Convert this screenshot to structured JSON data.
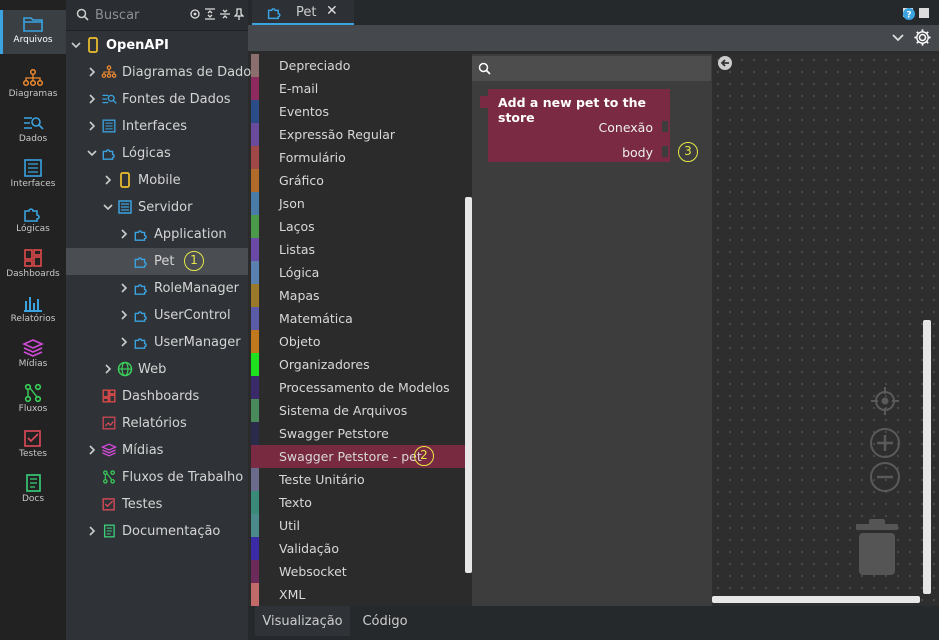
{
  "activity_bar": [
    {
      "label": "Arquivos",
      "icon": "folder-icon",
      "active": true
    },
    {
      "label": "Diagramas",
      "icon": "diagram-icon"
    },
    {
      "label": "Dados",
      "icon": "data-search-icon"
    },
    {
      "label": "Interfaces",
      "icon": "interface-icon"
    },
    {
      "label": "Lógicas",
      "icon": "puzzle-icon"
    },
    {
      "label": "Dashboards",
      "icon": "dashboard-icon"
    },
    {
      "label": "Relatórios",
      "icon": "report-icon"
    },
    {
      "label": "Mídias",
      "icon": "layers-icon"
    },
    {
      "label": "Fluxos",
      "icon": "flow-icon"
    },
    {
      "label": "Testes",
      "icon": "test-check-icon"
    },
    {
      "label": "Docs",
      "icon": "book-icon"
    }
  ],
  "explorer": {
    "search_placeholder": "Buscar",
    "tree": [
      {
        "label": "OpenAPI",
        "icon": "mobile-icon"
      },
      {
        "label": "Diagramas de Dados",
        "icon": "diagram-icon"
      },
      {
        "label": "Fontes de Dados",
        "icon": "data-search-icon"
      },
      {
        "label": "Interfaces",
        "icon": "interface-icon"
      },
      {
        "label": "Lógicas",
        "icon": "puzzle-icon"
      },
      {
        "label": "Mobile",
        "icon": "mobile-icon"
      },
      {
        "label": "Servidor",
        "icon": "server-icon"
      },
      {
        "label": "Application",
        "icon": "puzzle-icon"
      },
      {
        "label": "Pet",
        "icon": "puzzle-icon",
        "selected": true,
        "badge": "1"
      },
      {
        "label": "RoleManager",
        "icon": "puzzle-icon"
      },
      {
        "label": "UserControl",
        "icon": "puzzle-icon"
      },
      {
        "label": "UserManager",
        "icon": "puzzle-icon"
      },
      {
        "label": "Web",
        "icon": "globe-icon"
      },
      {
        "label": "Dashboards",
        "icon": "dashboard-icon"
      },
      {
        "label": "Relatórios",
        "icon": "report-icon"
      },
      {
        "label": "Mídias",
        "icon": "layers-icon"
      },
      {
        "label": "Fluxos de Trabalho",
        "icon": "flow-icon"
      },
      {
        "label": "Testes",
        "icon": "test-check-icon"
      },
      {
        "label": "Documentação",
        "icon": "book-icon"
      }
    ]
  },
  "editor_tab": {
    "label": "Pet",
    "close": "✕"
  },
  "palette": [
    {
      "label": "Depreciado",
      "color": "#8b6e6e"
    },
    {
      "label": "E-mail",
      "color": "#8e2a5e"
    },
    {
      "label": "Eventos",
      "color": "#2a4d88"
    },
    {
      "label": "Expressão Regular",
      "color": "#6a4a9a"
    },
    {
      "label": "Formulário",
      "color": "#a04848"
    },
    {
      "label": "Gráfico",
      "color": "#b06a2a"
    },
    {
      "label": "Json",
      "color": "#4a7aa6"
    },
    {
      "label": "Laços",
      "color": "#4a9a4a"
    },
    {
      "label": "Listas",
      "color": "#6a4aa6"
    },
    {
      "label": "Lógica",
      "color": "#5a80b0"
    },
    {
      "label": "Mapas",
      "color": "#9a7a2a"
    },
    {
      "label": "Matemática",
      "color": "#5a5aa6"
    },
    {
      "label": "Objeto",
      "color": "#c0781c"
    },
    {
      "label": "Organizadores",
      "color": "#1fe01f"
    },
    {
      "label": "Processamento de Modelos",
      "color": "#3a2a6a"
    },
    {
      "label": "Sistema de Arquivos",
      "color": "#4a8a5a"
    },
    {
      "label": "Swagger Petstore",
      "color": "#2a2a4a"
    },
    {
      "label": "Swagger Petstore - pet",
      "color": "#7a2a43",
      "selected": true,
      "badge": "2"
    },
    {
      "label": "Teste Unitário",
      "color": "#6a6a8a"
    },
    {
      "label": "Texto",
      "color": "#3a8a7a"
    },
    {
      "label": "Util",
      "color": "#4a8a8a"
    },
    {
      "label": "Validação",
      "color": "#3a2aa6"
    },
    {
      "label": "Websocket",
      "color": "#6a2a5a"
    },
    {
      "label": "XML",
      "color": "#c06a6a"
    }
  ],
  "block": {
    "title": "Add a new pet to the store",
    "input1": "Conexão",
    "input2": "body",
    "badge": "3",
    "color": "#7a2a43"
  },
  "bottom_tabs": [
    {
      "label": "Visualização",
      "active": true
    },
    {
      "label": "Código"
    }
  ],
  "colors": {
    "accent": "#3aa3e0",
    "badge": "#e6e84a"
  }
}
